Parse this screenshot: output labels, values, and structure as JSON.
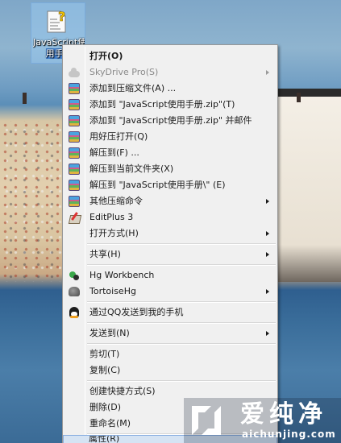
{
  "desktop": {
    "icon": {
      "name": "JavaScript使用手册",
      "line1": "JavaScript使",
      "line2": "用手册"
    }
  },
  "menu": {
    "items": [
      {
        "label": "打开(O)",
        "icon": "none",
        "bold": true
      },
      {
        "label": "SkyDrive Pro(S)",
        "icon": "cloud-icon",
        "disabled": true,
        "submenu": true
      },
      {
        "label": "添加到压缩文件(A) ...",
        "icon": "winrar-icon"
      },
      {
        "label": "添加到 \"JavaScript使用手册.zip\"(T)",
        "icon": "winrar-icon"
      },
      {
        "label": "添加到 \"JavaScript使用手册.zip\" 并邮件",
        "icon": "winrar-icon"
      },
      {
        "label": "用好压打开(Q)",
        "icon": "winrar-icon"
      },
      {
        "label": "解压到(F) ...",
        "icon": "winrar-icon"
      },
      {
        "label": "解压到当前文件夹(X)",
        "icon": "winrar-icon"
      },
      {
        "label": "解压到 \"JavaScript使用手册\\\" (E)",
        "icon": "winrar-icon"
      },
      {
        "label": "其他压缩命令",
        "icon": "winrar-icon",
        "submenu": true
      },
      {
        "label": "EditPlus 3",
        "icon": "editplus-icon"
      },
      {
        "label": "打开方式(H)",
        "icon": "none",
        "submenu": true
      },
      {
        "label": "共享(H)",
        "icon": "none",
        "submenu": true
      },
      {
        "label": "Hg Workbench",
        "icon": "hg-icon"
      },
      {
        "label": "TortoiseHg",
        "icon": "tortoisehg-icon",
        "submenu": true
      },
      {
        "label": "通过QQ发送到我的手机",
        "icon": "qq-icon"
      },
      {
        "label": "发送到(N)",
        "icon": "none",
        "submenu": true
      },
      {
        "label": "剪切(T)",
        "icon": "none"
      },
      {
        "label": "复制(C)",
        "icon": "none"
      },
      {
        "label": "创建快捷方式(S)",
        "icon": "none"
      },
      {
        "label": "删除(D)",
        "icon": "none"
      },
      {
        "label": "重命名(M)",
        "icon": "none"
      },
      {
        "label": "属性(R)",
        "icon": "none",
        "selected": true
      }
    ]
  },
  "watermark": {
    "text_cn": "爱纯净",
    "text_en": "aichunjing.com"
  },
  "colors": {
    "menu_bg": "#f0f0f0",
    "selection": "#d5e3f3",
    "disabled_text": "#8a8a8a"
  }
}
